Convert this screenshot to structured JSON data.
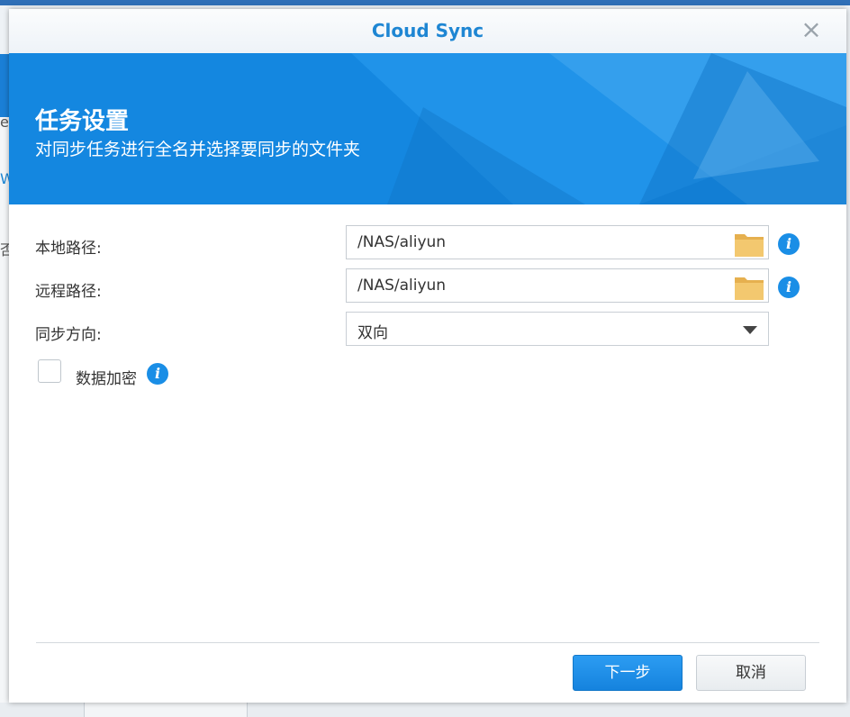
{
  "dialog": {
    "title": "Cloud Sync",
    "close_label": "×"
  },
  "banner": {
    "title": "任务设置",
    "subtitle": "对同步任务进行全名并选择要同步的文件夹"
  },
  "form": {
    "local_path": {
      "label": "本地路径:",
      "value": "/NAS/aliyun"
    },
    "remote_path": {
      "label": "远程路径:",
      "value": "/NAS/aliyun"
    },
    "sync_direction": {
      "label": "同步方向:",
      "value": "双向"
    },
    "encrypt": {
      "label": "数据加密",
      "checked": false
    }
  },
  "buttons": {
    "next": "下一步",
    "cancel": "取消"
  },
  "background": {
    "frag1": "e",
    "frag2": "W",
    "frag3": "否"
  },
  "colors": {
    "accent": "#1e86d3",
    "banner": "#1487e0",
    "folder": "#f0c36d",
    "info": "#1a8ee6"
  }
}
